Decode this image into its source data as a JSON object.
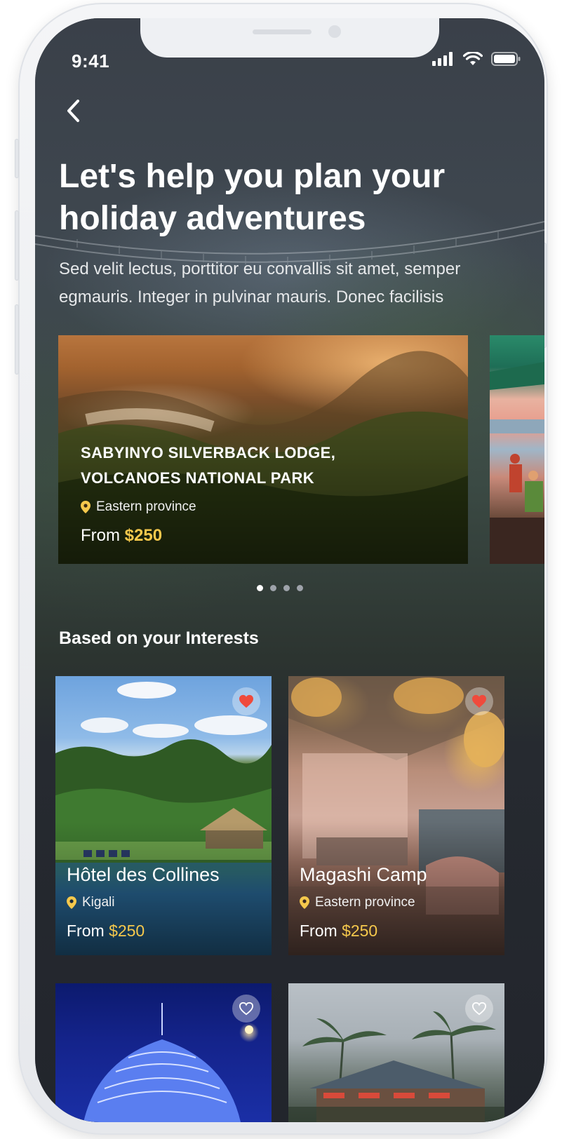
{
  "status_bar": {
    "time": "9:41"
  },
  "header": {
    "back_icon": "chevron-left-icon",
    "title_line1": "Let's help you plan your",
    "title_line2": "holiday adventures",
    "subtitle_line1": "Sed velit lectus, porttitor eu convallis sit amet, semper",
    "subtitle_line2": "egmauris. Integer in pulvinar mauris. Donec facilisis"
  },
  "featured": {
    "title_line1": "SABYINYO SILVERBACK LODGE,",
    "title_line2": "VOLCANOES NATIONAL PARK",
    "location": "Eastern province",
    "price_prefix": "From",
    "price": "$250",
    "dots_total": 4,
    "active_dot": 0
  },
  "interests": {
    "section_title": "Based on your Interests",
    "cards": [
      {
        "title": "Hôtel des Collines",
        "location": "Kigali",
        "price_prefix": "From",
        "price": "$250",
        "favorited": true
      },
      {
        "title": "Magashi Camp",
        "location": "Eastern province",
        "price_prefix": "From",
        "price": "$250",
        "favorited": true
      },
      {
        "favorited": false
      },
      {
        "favorited": false
      }
    ]
  },
  "colors": {
    "accent_price": "#f5c84c",
    "heart_active": "#ef4a3c",
    "location_pin": "#f5c84c"
  }
}
